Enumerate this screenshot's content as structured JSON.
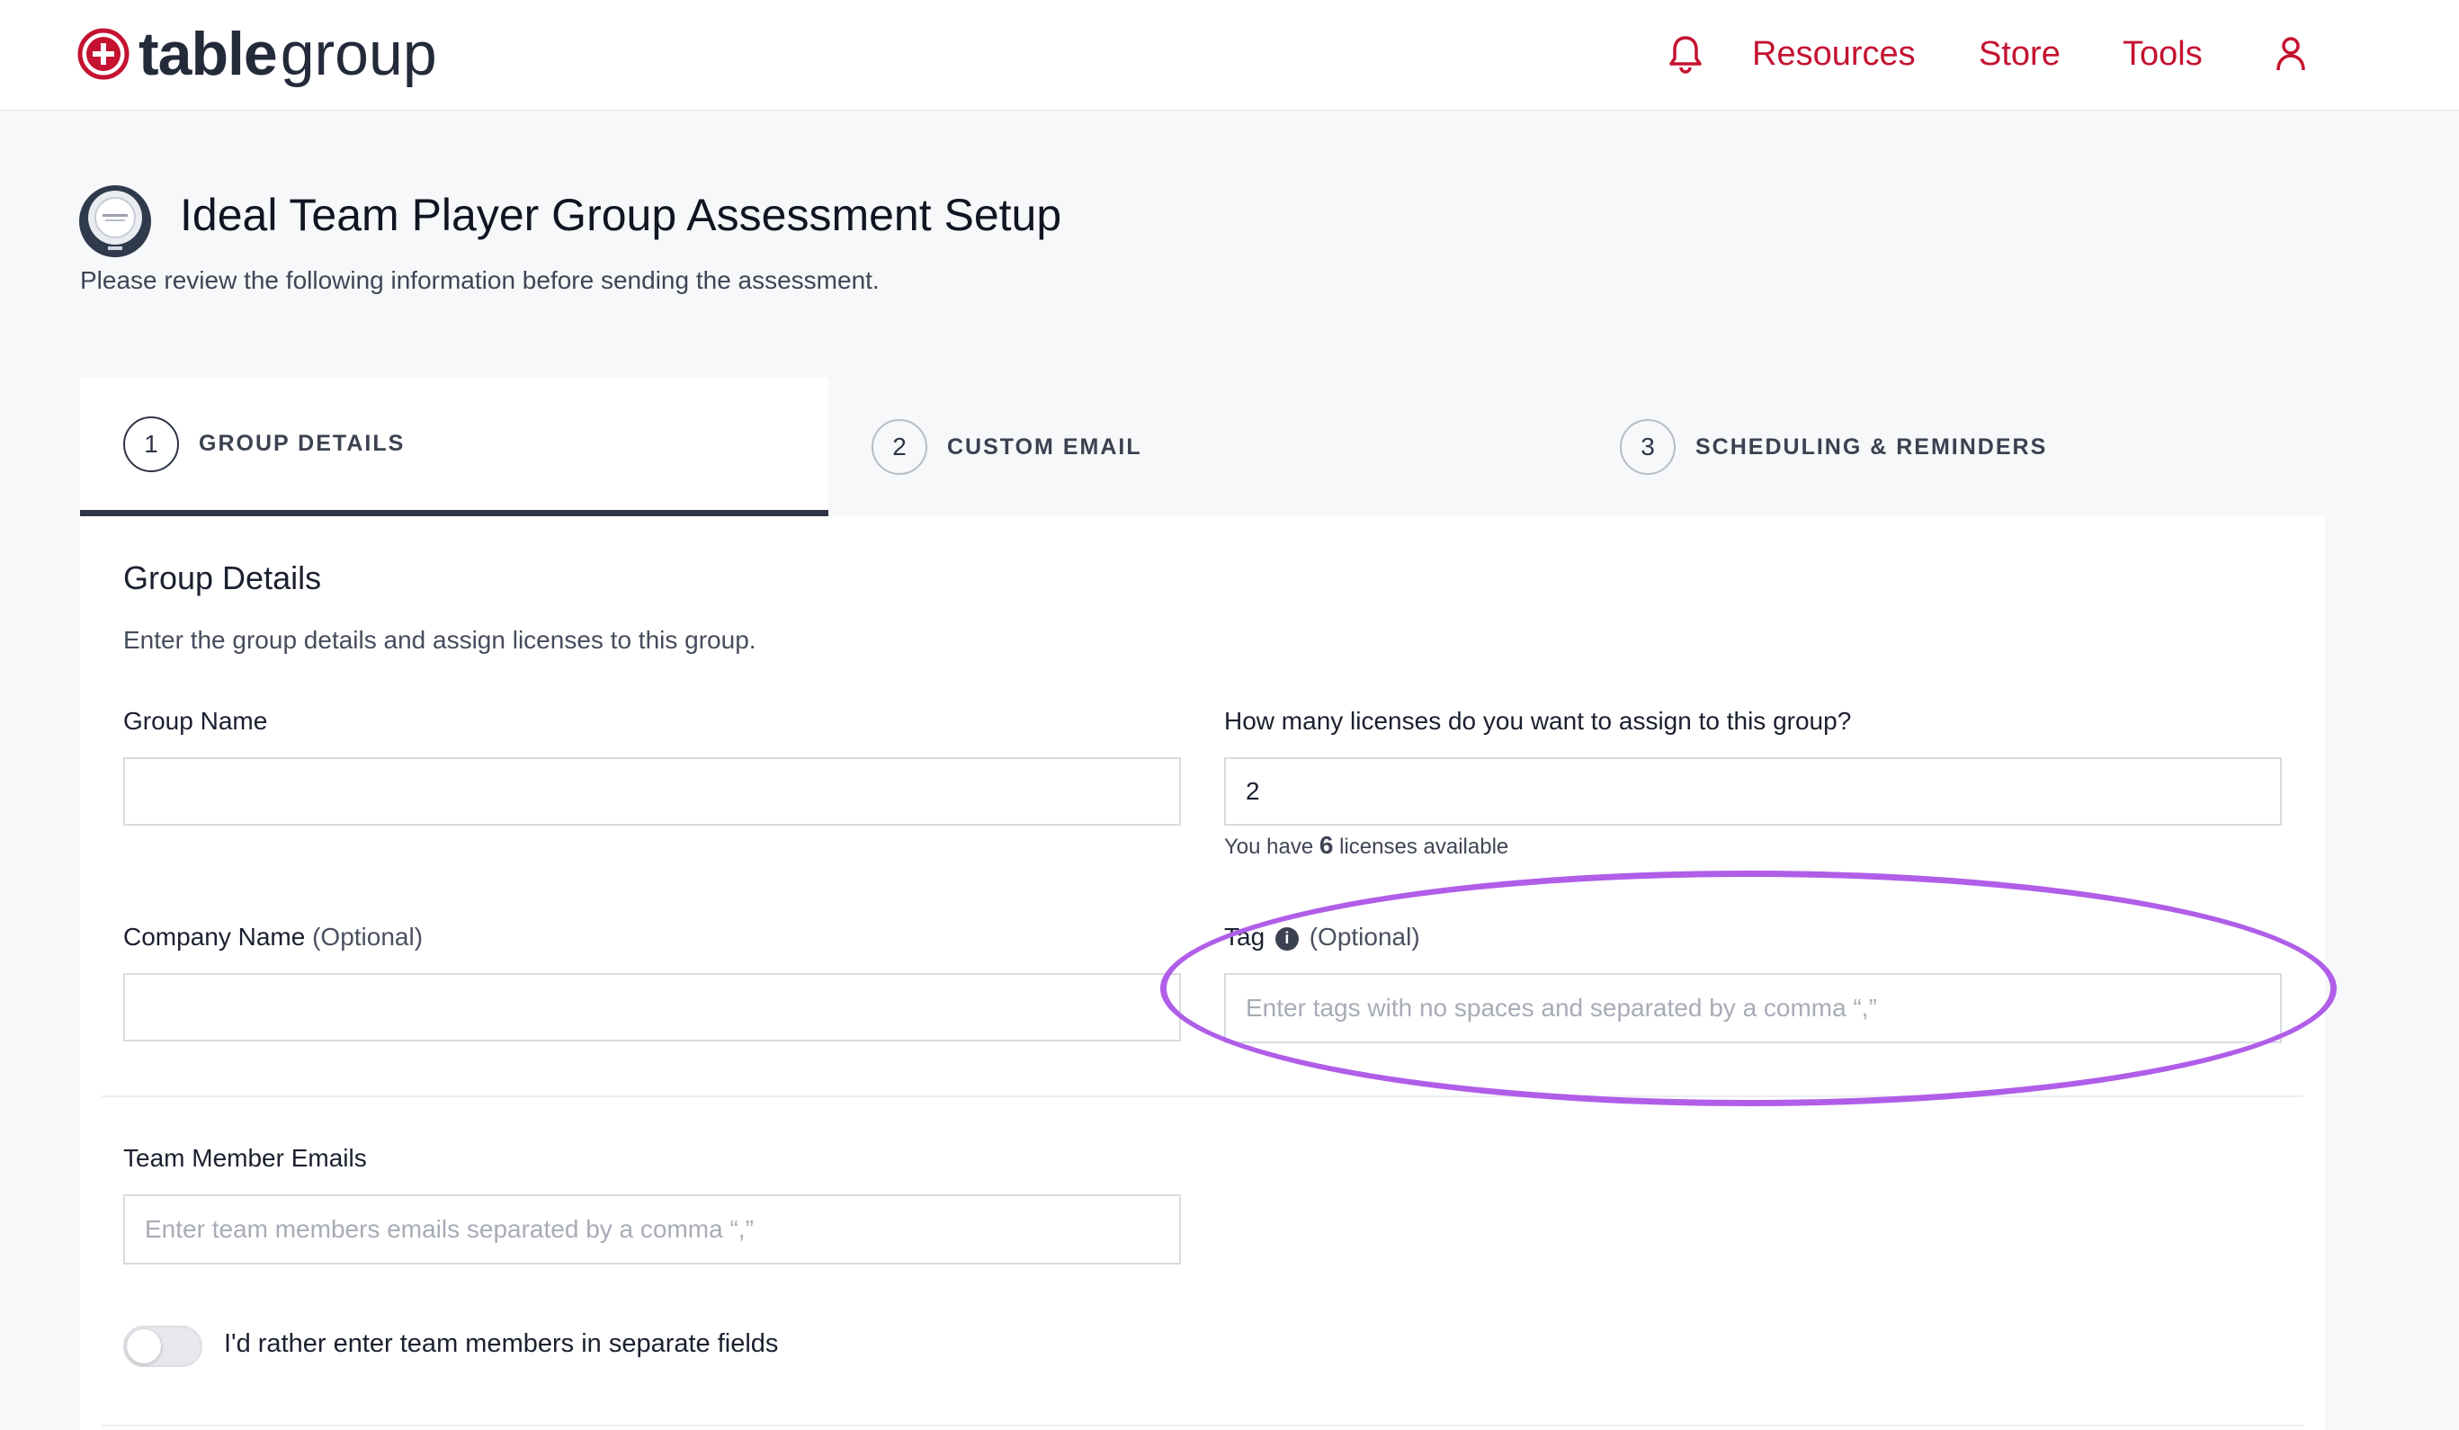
{
  "header": {
    "logo_bold": "table",
    "logo_light": "group",
    "nav": {
      "bell_icon": "bell-icon",
      "resources": "Resources",
      "store": "Store",
      "tools": "Tools",
      "user_icon": "user-icon"
    }
  },
  "page": {
    "title": "Ideal Team Player Group Assessment Setup",
    "subtitle": "Please review the following information before sending the assessment."
  },
  "tabs": [
    {
      "num": "1",
      "label": "GROUP DETAILS",
      "active": true
    },
    {
      "num": "2",
      "label": "CUSTOM EMAIL",
      "active": false
    },
    {
      "num": "3",
      "label": "SCHEDULING & REMINDERS",
      "active": false
    }
  ],
  "form": {
    "section_title": "Group Details",
    "section_sub": "Enter the group details and assign licenses to this group.",
    "group_name": {
      "label": "Group Name",
      "value": ""
    },
    "licenses": {
      "label": "How many licenses do you want to assign to this group?",
      "value": "2",
      "help_prefix": "You have",
      "help_count": "6",
      "help_suffix": "licenses available"
    },
    "company_name": {
      "label": "Company Name",
      "optional": "(Optional)",
      "value": ""
    },
    "tag": {
      "label": "Tag",
      "optional": "(Optional)",
      "info_icon": "info-icon",
      "placeholder": "Enter tags with no spaces and separated by a comma “,”"
    },
    "emails": {
      "label": "Team Member Emails",
      "placeholder": "Enter team members emails separated by a comma “,”"
    },
    "toggle": {
      "label": "I'd rather enter team members in separate fields",
      "on": false
    }
  },
  "colors": {
    "accent": "#c41230",
    "highlight": "#b05ee8",
    "dark": "#2d3446"
  }
}
